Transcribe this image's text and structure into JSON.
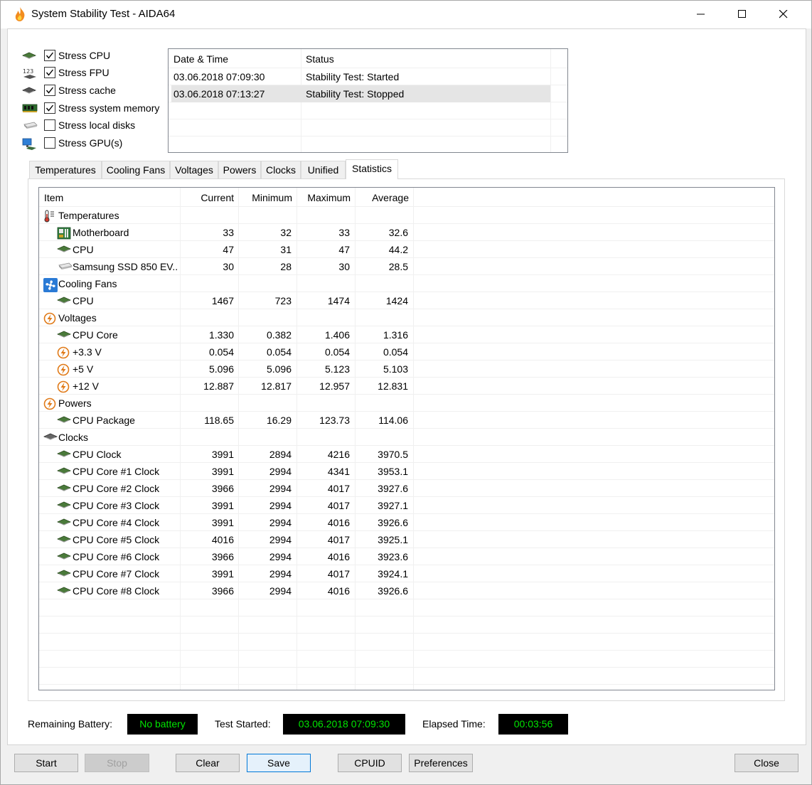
{
  "window": {
    "title": "System Stability Test - AIDA64"
  },
  "stress_options": [
    {
      "label": "Stress CPU",
      "checked": true,
      "icon": "cpu-chip-icon"
    },
    {
      "label": "Stress FPU",
      "checked": true,
      "icon": "fpu-123-icon"
    },
    {
      "label": "Stress cache",
      "checked": true,
      "icon": "cache-chip-icon"
    },
    {
      "label": "Stress system memory",
      "checked": true,
      "icon": "memory-module-icon"
    },
    {
      "label": "Stress local disks",
      "checked": false,
      "icon": "disk-drive-icon"
    },
    {
      "label": "Stress GPU(s)",
      "checked": false,
      "icon": "gpu-monitor-icon"
    }
  ],
  "log": {
    "headers": [
      "Date & Time",
      "Status"
    ],
    "rows": [
      {
        "datetime": "03.06.2018 07:09:30",
        "status": "Stability Test: Started"
      },
      {
        "datetime": "03.06.2018 07:13:27",
        "status": "Stability Test: Stopped"
      }
    ]
  },
  "tabs": [
    "Temperatures",
    "Cooling Fans",
    "Voltages",
    "Powers",
    "Clocks",
    "Unified",
    "Statistics"
  ],
  "active_tab": "Statistics",
  "stats": {
    "headers": {
      "item": "Item",
      "current": "Current",
      "minimum": "Minimum",
      "maximum": "Maximum",
      "average": "Average"
    },
    "rows": [
      {
        "type": "group",
        "item": "Temperatures",
        "icon": "thermometer-icon"
      },
      {
        "type": "data",
        "item": "Motherboard",
        "icon": "motherboard-icon",
        "current": "33",
        "minimum": "32",
        "maximum": "33",
        "average": "32.6"
      },
      {
        "type": "data",
        "item": "CPU",
        "icon": "cpu-chip-icon",
        "current": "47",
        "minimum": "31",
        "maximum": "47",
        "average": "44.2"
      },
      {
        "type": "data",
        "item": "Samsung SSD 850 EV...",
        "icon": "ssd-icon",
        "current": "30",
        "minimum": "28",
        "maximum": "30",
        "average": "28.5"
      },
      {
        "type": "group",
        "item": "Cooling Fans",
        "icon": "fan-icon"
      },
      {
        "type": "data",
        "item": "CPU",
        "icon": "cpu-chip-icon",
        "current": "1467",
        "minimum": "723",
        "maximum": "1474",
        "average": "1424"
      },
      {
        "type": "group",
        "item": "Voltages",
        "icon": "lightning-icon"
      },
      {
        "type": "data",
        "item": "CPU Core",
        "icon": "cpu-chip-icon",
        "current": "1.330",
        "minimum": "0.382",
        "maximum": "1.406",
        "average": "1.316"
      },
      {
        "type": "data",
        "item": "+3.3 V",
        "icon": "lightning-icon",
        "current": "0.054",
        "minimum": "0.054",
        "maximum": "0.054",
        "average": "0.054"
      },
      {
        "type": "data",
        "item": "+5 V",
        "icon": "lightning-icon",
        "current": "5.096",
        "minimum": "5.096",
        "maximum": "5.123",
        "average": "5.103"
      },
      {
        "type": "data",
        "item": "+12 V",
        "icon": "lightning-icon",
        "current": "12.887",
        "minimum": "12.817",
        "maximum": "12.957",
        "average": "12.831"
      },
      {
        "type": "group",
        "item": "Powers",
        "icon": "lightning-icon"
      },
      {
        "type": "data",
        "item": "CPU Package",
        "icon": "cpu-chip-icon",
        "current": "118.65",
        "minimum": "16.29",
        "maximum": "123.73",
        "average": "114.06"
      },
      {
        "type": "group",
        "item": "Clocks",
        "icon": "clock-chip-icon"
      },
      {
        "type": "data",
        "item": "CPU Clock",
        "icon": "cpu-chip-icon",
        "current": "3991",
        "minimum": "2894",
        "maximum": "4216",
        "average": "3970.5"
      },
      {
        "type": "data",
        "item": "CPU Core #1 Clock",
        "icon": "cpu-chip-icon",
        "current": "3991",
        "minimum": "2994",
        "maximum": "4341",
        "average": "3953.1"
      },
      {
        "type": "data",
        "item": "CPU Core #2 Clock",
        "icon": "cpu-chip-icon",
        "current": "3966",
        "minimum": "2994",
        "maximum": "4017",
        "average": "3927.6"
      },
      {
        "type": "data",
        "item": "CPU Core #3 Clock",
        "icon": "cpu-chip-icon",
        "current": "3991",
        "minimum": "2994",
        "maximum": "4017",
        "average": "3927.1"
      },
      {
        "type": "data",
        "item": "CPU Core #4 Clock",
        "icon": "cpu-chip-icon",
        "current": "3991",
        "minimum": "2994",
        "maximum": "4016",
        "average": "3926.6"
      },
      {
        "type": "data",
        "item": "CPU Core #5 Clock",
        "icon": "cpu-chip-icon",
        "current": "4016",
        "minimum": "2994",
        "maximum": "4017",
        "average": "3925.1"
      },
      {
        "type": "data",
        "item": "CPU Core #6 Clock",
        "icon": "cpu-chip-icon",
        "current": "3966",
        "minimum": "2994",
        "maximum": "4016",
        "average": "3923.6"
      },
      {
        "type": "data",
        "item": "CPU Core #7 Clock",
        "icon": "cpu-chip-icon",
        "current": "3991",
        "minimum": "2994",
        "maximum": "4017",
        "average": "3924.1"
      },
      {
        "type": "data",
        "item": "CPU Core #8 Clock",
        "icon": "cpu-chip-icon",
        "current": "3966",
        "minimum": "2994",
        "maximum": "4016",
        "average": "3926.6"
      }
    ]
  },
  "status": {
    "battery_label": "Remaining Battery:",
    "battery_value": "No battery",
    "started_label": "Test Started:",
    "started_value": "03.06.2018 07:09:30",
    "elapsed_label": "Elapsed Time:",
    "elapsed_value": "00:03:56"
  },
  "buttons": {
    "start": "Start",
    "stop": "Stop",
    "clear": "Clear",
    "save": "Save",
    "cpuid": "CPUID",
    "preferences": "Preferences",
    "close": "Close"
  }
}
